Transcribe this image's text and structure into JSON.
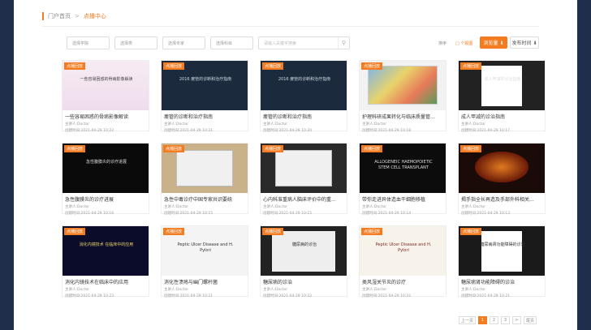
{
  "breadcrumb": {
    "home": "门户首页",
    "separator": ">",
    "current": "点播中心"
  },
  "filters": {
    "department": "选择学院",
    "category": "选择类",
    "doctor": "选择专家",
    "subject": "选择科目",
    "search_placeholder": "请输入关键字搜索"
  },
  "toolbar": {
    "sort_label": "排序",
    "grid_label": "□ 个视图",
    "views_button": "浏览量 ⬇",
    "time_button": "发布时间 ⬇"
  },
  "badge": "点播回放",
  "cards": [
    {
      "title": "一些容易困惑的骨病影像解读",
      "speaker": "主讲人:Doctor",
      "time": "创建时间:2021-04-29 10:22",
      "thumb_text": "一些容易困惑的骨病影像解读"
    },
    {
      "title": "瘘管的诊断和治疗指南",
      "speaker": "主讲人:Doctor",
      "time": "创建时间:2021-04-29 10:21",
      "thumb_text": "2016 瘘管的诊断和治疗指南"
    },
    {
      "title": "瘘管的诊断和治疗指南",
      "speaker": "主讲人:Doctor",
      "time": "创建时间:2021-04-29 10:20",
      "thumb_text": "2016 瘘管的诊断和治疗指南"
    },
    {
      "title": "护理科研成果转化与临床质量管...",
      "speaker": "主讲人:Doctor",
      "time": "创建时间:2021-04-29 10:18",
      "thumb_text": ""
    },
    {
      "title": "成人甲减的诊治指南",
      "speaker": "主讲人:Doctor",
      "time": "创建时间:2021-04-29 10:17",
      "thumb_text": "成人甲减的诊治指南"
    },
    {
      "title": "急性腹膜炎的诊疗进展",
      "speaker": "主讲人:Doctor",
      "time": "创建时间:2021-04-29 10:16",
      "thumb_text": "急性腹膜炎的诊疗进展"
    },
    {
      "title": "急性中毒诊疗中国专家共识要统",
      "speaker": "主讲人:Doctor",
      "time": "创建时间:2021-04-29 10:15",
      "thumb_text": ""
    },
    {
      "title": "心内科准重病人脑床评价中的重...",
      "speaker": "主讲人:Doctor",
      "time": "创建时间:2021-04-29 10:15",
      "thumb_text": ""
    },
    {
      "title": "带你走进异体造血干细胞移植",
      "speaker": "主讲人:Doctor",
      "time": "创建时间:2021-04-29 10:14",
      "thumb_text": "ALLOGENEIC HAEMOPOIETIC STEM CELL TRANSPLANT"
    },
    {
      "title": "揭手指全长再造及手部外科相关...",
      "speaker": "主讲人:Doctor",
      "time": "创建时间:2021-04-29 10:13",
      "thumb_text": ""
    },
    {
      "title": "消化内镜技术在临床中的应用",
      "speaker": "主讲人:Doctor",
      "time": "创建时间:2021-04-29 10:23",
      "thumb_text": "消化内镜技术 在临床中的应用"
    },
    {
      "title": "消化性溃疡与幽门螺杆菌",
      "speaker": "主讲人:Doctor",
      "time": "创建时间:2021-04-29 10:21",
      "thumb_text": "Peptic Ulcer Disease and H. Pylori"
    },
    {
      "title": "糖尿病的诊治",
      "speaker": "主讲人:Doctor",
      "time": "创建时间:2021-04-29 10:22",
      "thumb_text": "糖尿病的诊治"
    },
    {
      "title": "类风湿关节炎的诊疗",
      "speaker": "主讲人:Doctor",
      "time": "创建时间:2021-04-29 10:22",
      "thumb_text": "Peptic Ulcer Disease and H. Pylori"
    },
    {
      "title": "糖尿病肾功能障碍的诊治",
      "speaker": "主讲人:Doctor",
      "time": "创建时间:2021-04-29 10:21",
      "thumb_text": "糖尿病肾功能障碍的诊治"
    }
  ],
  "pagination": {
    "prev": "上一页",
    "pages": [
      "1",
      "2",
      "3"
    ],
    "next": ">",
    "last": "尾页"
  },
  "colors": {
    "accent": "#f47b20",
    "background": "#1f2e4a"
  }
}
